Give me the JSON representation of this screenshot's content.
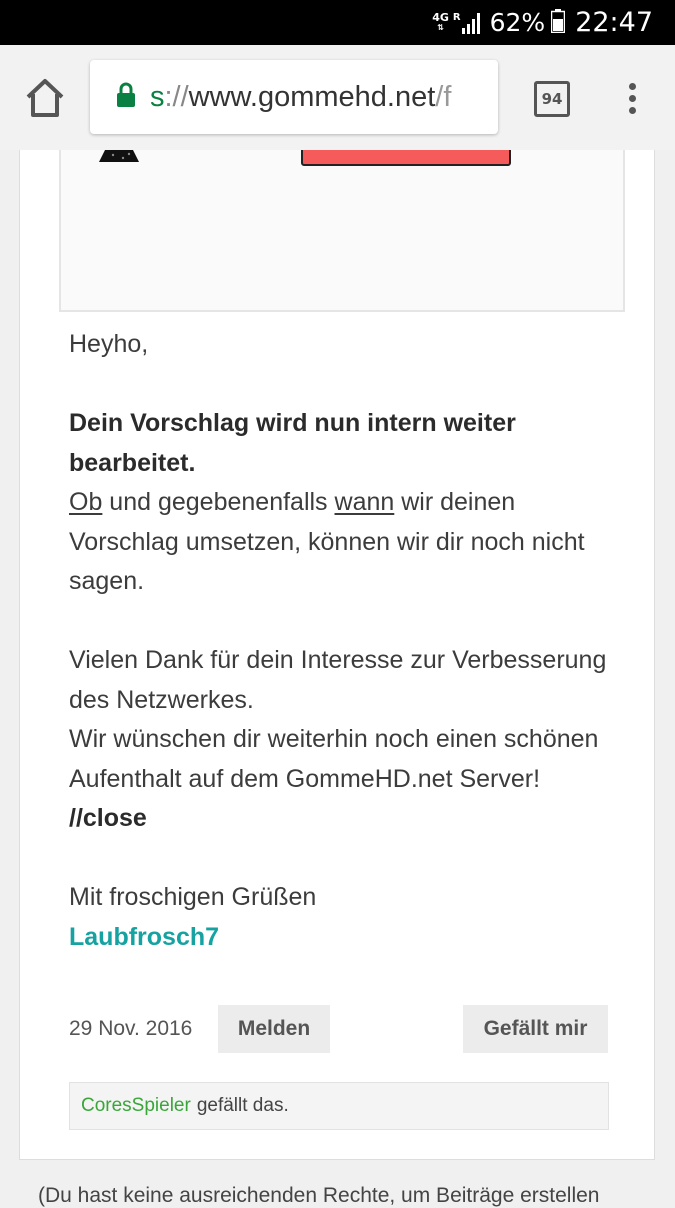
{
  "status_bar": {
    "network": "4G",
    "roaming": "R",
    "battery_percent": "62%",
    "time": "22:47"
  },
  "browser": {
    "url_scheme": "s",
    "url_sep": "://",
    "url_host": "www.gommehd.net",
    "url_rest": "/f",
    "tab_count": "94",
    "icons": [
      "home-icon",
      "lock-icon",
      "tab-switcher-icon",
      "overflow-menu-icon"
    ]
  },
  "post": {
    "greeting": "Heyho,",
    "bold_line": "Dein Vorschlag wird nun intern weiter bearbeitet.",
    "line2_ob": "Ob",
    "line2_mid": " und gegebenenfalls ",
    "line2_wann": "wann",
    "line2_end": " wir deinen Vorschlag umsetzen, können wir dir noch nicht sagen.",
    "thanks": "Vielen Dank für dein Interesse zur Verbesserung des Netzwerkes.",
    "wish": "Wir wünschen dir weiterhin noch einen schönen Aufenthalt auf dem GommeHD.net Server!",
    "close": "//close",
    "signoff": "Mit froschigen Grüßen",
    "author": "Laubfrosch7"
  },
  "meta": {
    "date": "29 Nov. 2016",
    "report_label": "Melden",
    "like_label": "Gefällt mir"
  },
  "likes": {
    "user": "CoresSpieler",
    "suffix": "gefällt das."
  },
  "footer": {
    "note": "(Du hast keine ausreichenden Rechte, um Beiträge erstellen"
  },
  "colors": {
    "link_secure": "#0b8043",
    "author": "#17a2a2",
    "liker": "#3aa63a",
    "banner": "#f55b5b"
  }
}
